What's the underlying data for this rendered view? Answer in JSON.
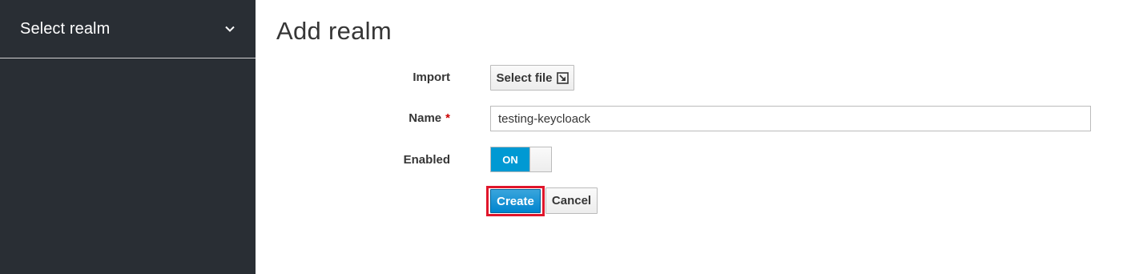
{
  "sidebar": {
    "realm_selector": {
      "label": "Select realm",
      "icon": "chevron-down-icon"
    }
  },
  "main": {
    "title": "Add realm",
    "form": {
      "import": {
        "label": "Import",
        "button_label": "Select file",
        "button_icon": "external-link-icon"
      },
      "name": {
        "label": "Name",
        "required_marker": "*",
        "value": "testing-keycloack"
      },
      "enabled": {
        "label": "Enabled",
        "toggle_text": "ON",
        "state": true
      },
      "actions": {
        "create_label": "Create",
        "cancel_label": "Cancel"
      }
    }
  },
  "colors": {
    "sidebar_bg": "#292e34",
    "primary": "#0088ce",
    "toggle_on": "#0099d3",
    "highlight": "#e0162b",
    "required": "#cc0000"
  }
}
